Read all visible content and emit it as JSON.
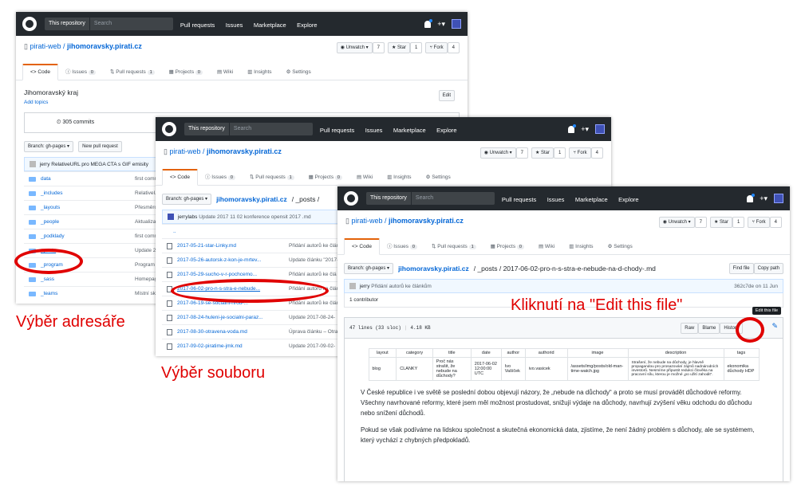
{
  "header": {
    "scope": "This repository",
    "search_placeholder": "Search",
    "nav": [
      "Pull requests",
      "Issues",
      "Marketplace",
      "Explore"
    ]
  },
  "repo": {
    "owner": "pirati-web",
    "name": "jihomoravsky.pirati.cz",
    "unwatch": "Unwatch",
    "unwatch_count": "7",
    "star": "Star",
    "star_count": "1",
    "fork": "Fork",
    "fork_count": "4"
  },
  "tabs": {
    "code": "Code",
    "issues": "Issues",
    "issues_count": "0",
    "pulls": "Pull requests",
    "pulls_count": "1",
    "projects": "Projects",
    "projects_count": "0",
    "wiki": "Wiki",
    "insights": "Insights",
    "settings": "Settings"
  },
  "shot1": {
    "description": "Jihomoravský kraj",
    "add_topics": "Add topics",
    "edit": "Edit",
    "commits": "305 commits",
    "branch": "Branch: gh-pages",
    "new_pr": "New pull request",
    "last_commit": "jerry RelativeURL pro MEGA CTA s GIF emisity",
    "files": [
      {
        "name": "data",
        "msg": "first comm"
      },
      {
        "name": "_includes",
        "msg": "RelativeUR"
      },
      {
        "name": "_layouts",
        "msg": "Přesměrov"
      },
      {
        "name": "_people",
        "msg": "Aktualizac"
      },
      {
        "name": "_podklady",
        "msg": "first comm"
      },
      {
        "name": "_posts",
        "msg": "Update 20"
      },
      {
        "name": "_program",
        "msg": "Program v"
      },
      {
        "name": "_sass",
        "msg": "Homepage"
      },
      {
        "name": "_teams",
        "msg": "Místní skú"
      }
    ]
  },
  "shot2": {
    "branch": "Branch: gh-pages",
    "path_sep": "/ _posts /",
    "last_commit_user": "jerrylabs",
    "last_commit_msg": "Update 2017 11 02 konference opensit 2017 .md",
    "up": "..",
    "files": [
      {
        "name": "2017-05-21-star-Linky.md",
        "msg": "Přidání autorů ke člán"
      },
      {
        "name": "2017-05-26-autorsk-z-kon-je-mrtev...",
        "msg": "Update článku \"2017-"
      },
      {
        "name": "2017-05-29-sucho-v-r-pochcemo...",
        "msg": "Přidání autorů ke člá"
      },
      {
        "name": "2017-06-02-pro-n-s-stra-e-nebude...",
        "msg": "Přidání autorů ke člán"
      },
      {
        "name": "2017-06-19-se-socialni-hrou-...",
        "msg": "Přidání autorů ke člán"
      },
      {
        "name": "2017-08-24-huleni-je-socialni-paraz...",
        "msg": "Update 2017-08-24-"
      },
      {
        "name": "2017-08-30-otravena-voda.md",
        "msg": "Úprava článku – Otrav"
      },
      {
        "name": "2017-09-02-piratime-jmk.md",
        "msg": "Update 2017-09-02-"
      }
    ]
  },
  "shot3": {
    "branch": "Branch: gh-pages",
    "breadcrumb_file": "/ _posts / 2017-06-02-pro-n-s-stra-e-nebude-na-d-chody-.md",
    "find_file": "Find file",
    "copy_path": "Copy path",
    "commit_user": "jerry",
    "commit_msg": "Přidání autorů ke článkům",
    "commit_meta": "362c7de on 11 Jun",
    "contributors": "1 contributor",
    "file_info": "47 lines (33 sloc)",
    "file_size": "4.18 KB",
    "raw": "Raw",
    "blame": "Blame",
    "history": "History",
    "tooltip": "Edit this file",
    "fm_headers": [
      "layout",
      "category",
      "title",
      "date",
      "author",
      "authorid",
      "image",
      "description",
      "tags"
    ],
    "fm_values": [
      "blog",
      "CLANKY",
      "Proč nás strašit, že nebude na důchody?",
      "2017-06-02 12:00:00 UTC",
      "Ivo Vašíček",
      "ivo.vasicek",
      "/assets/img/posts/old-man-time-watch.jpg",
      "Strašení, že nebude na důchody, je hlavně propagandou pro prosazování zájmů nadnárodních investorů. Nesmíme připustit redukci člověka na pracovní sílu, kterou je možné „po užití zahodit“.",
      "ekonomika důchody HDP"
    ],
    "p1": "V České republice i ve světě se poslední dobou objevují názory, že „nebude na důchody“ a proto se musí provádět důchodové reformy. Všechny navrhované reformy, které jsem měl možnost prostudovat, snižují výdaje na důchody, navrhují zvýšení věku odchodu do důchodu nebo snížení důchodů.",
    "p2": "Pokud se však podíváme na lidskou společnost a skutečná ekonomická data, zjistíme, že není žádný problém s důchody, ale se systémem, který vychází z chybných předpokladů."
  },
  "annotations": {
    "step1": "Výběr adresáře",
    "step2": "Výběr souboru",
    "step3": "Kliknutí na \"Edit this file\""
  },
  "colors": {
    "header_bg": "#24292e",
    "link": "#0366d6",
    "annotation_red": "#e00000",
    "tab_accent": "#e36209"
  }
}
